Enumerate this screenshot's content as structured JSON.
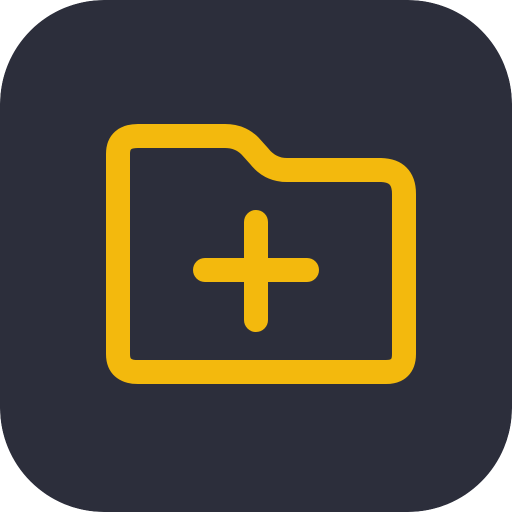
{
  "icon": {
    "name": "new-folder-icon",
    "glyph": "folder-plus-icon",
    "colors": {
      "background": "#2c2e3b",
      "accent": "#f3b90d"
    }
  }
}
